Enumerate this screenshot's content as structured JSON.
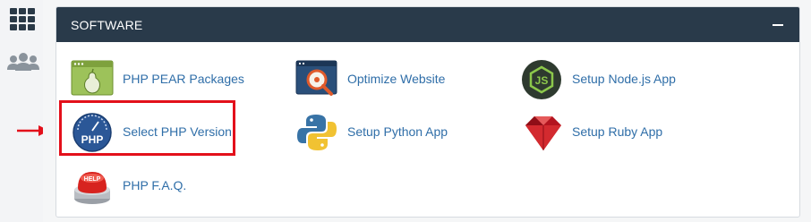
{
  "panel": {
    "title": "SOFTWARE",
    "collapse_icon": "minus-icon"
  },
  "sidebar": {
    "icons": [
      "grid-apps-icon",
      "users-icon"
    ]
  },
  "items": [
    {
      "label": "PHP PEAR Packages",
      "icon": "pear-window-icon"
    },
    {
      "label": "Optimize Website",
      "icon": "optimize-magnifier-icon"
    },
    {
      "label": "Setup Node.js App",
      "icon": "nodejs-hexagon-icon"
    },
    {
      "label": "Select PHP Version",
      "icon": "php-gauge-icon"
    },
    {
      "label": "Setup Python App",
      "icon": "python-logo-icon"
    },
    {
      "label": "Setup Ruby App",
      "icon": "ruby-gem-icon"
    },
    {
      "label": "PHP F.A.Q.",
      "icon": "help-button-icon"
    }
  ],
  "colors": {
    "header_bg": "#293a4a",
    "link": "#2f6ea8",
    "highlight": "#e3101b"
  }
}
